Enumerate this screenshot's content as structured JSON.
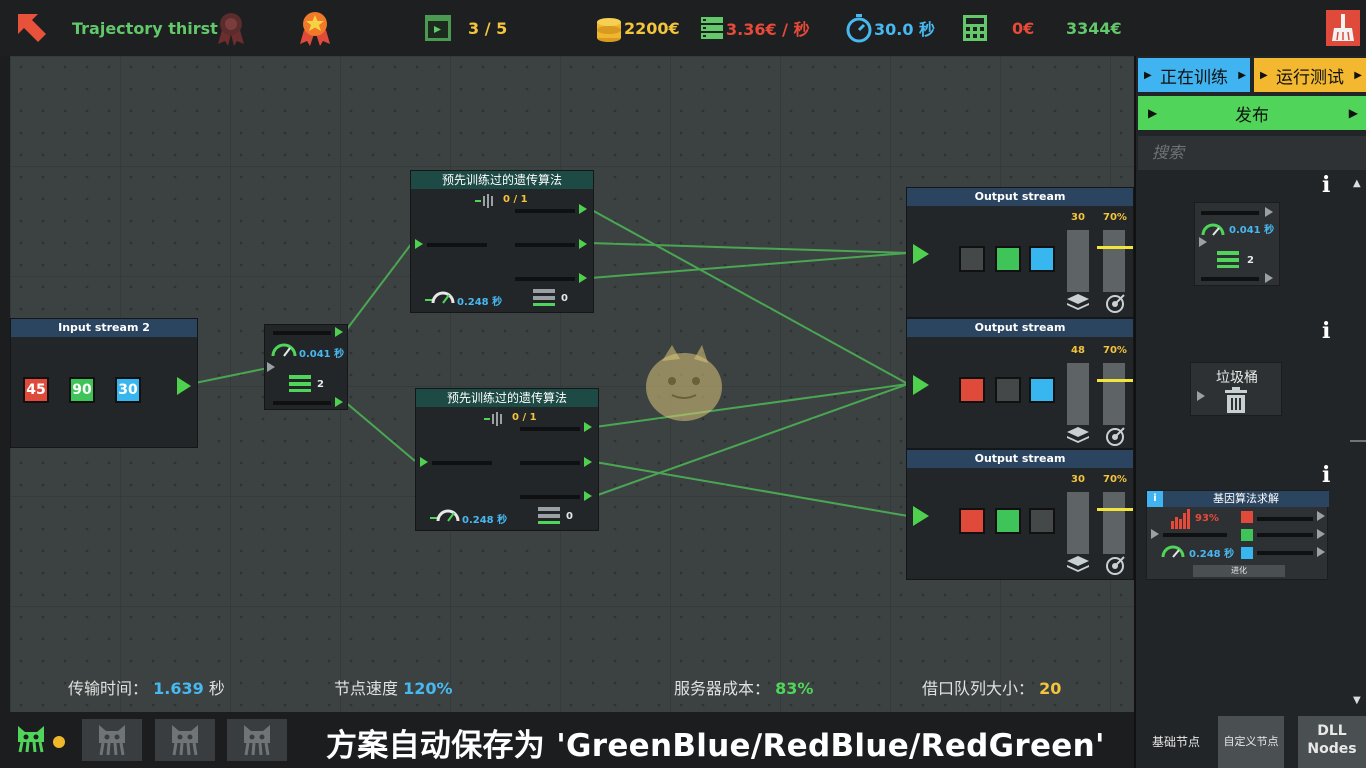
{
  "topbar": {
    "title": "Trajectory thirst",
    "level": "3 / 5",
    "money": "2200€",
    "rate": "3.36€ / 秒",
    "time": "30.0 秒",
    "cost": "0€",
    "score": "3344€"
  },
  "nodes": {
    "input": {
      "title": "Input stream 2",
      "values": [
        "45",
        "90",
        "30"
      ]
    },
    "splitter": {
      "time": "0.041 秒",
      "count": "2"
    },
    "algo1": {
      "title": "预先训练过的遗传算法",
      "progress": "0 / 1",
      "time": "0.248 秒",
      "count": "0"
    },
    "algo2": {
      "title": "预先训练过的遗传算法",
      "progress": "0 / 1",
      "time": "0.248 秒",
      "count": "0"
    },
    "outputs": [
      {
        "title": "Output stream",
        "count": "30",
        "percent": "70%"
      },
      {
        "title": "Output stream",
        "count": "48",
        "percent": "70%"
      },
      {
        "title": "Output stream",
        "count": "30",
        "percent": "70%"
      }
    ]
  },
  "stats": {
    "transfer_label": "传输时间：",
    "transfer_value": "1.639",
    "transfer_unit": "秒",
    "speed_label": "节点速度",
    "speed_value": "120%",
    "server_label": "服务器成本：",
    "server_value": "83%",
    "queue_label": "借口队列大小：",
    "queue_value": "20"
  },
  "save_message": "方案自动保存为 'GreenBlue/RedBlue/RedGreen'",
  "panel": {
    "training_label": "正在训练",
    "test_label": "运行测试",
    "publish_label": "发布",
    "search_placeholder": "搜索",
    "palette_splitter": {
      "time": "0.041 秒",
      "count": "2"
    },
    "trash_label": "垃圾桶",
    "ga_solver": {
      "title": "基因算法求解",
      "percent": "93%",
      "time": "0.248 秒",
      "evolve_label": "进化"
    },
    "tabs": [
      "基础节点",
      "自定义节点",
      "DLL\nNodes"
    ]
  },
  "colors": {
    "accent_green": "#50d45a",
    "accent_yellow": "#f3c43c",
    "accent_blue": "#48b8f0",
    "accent_red": "#e84a3a"
  }
}
